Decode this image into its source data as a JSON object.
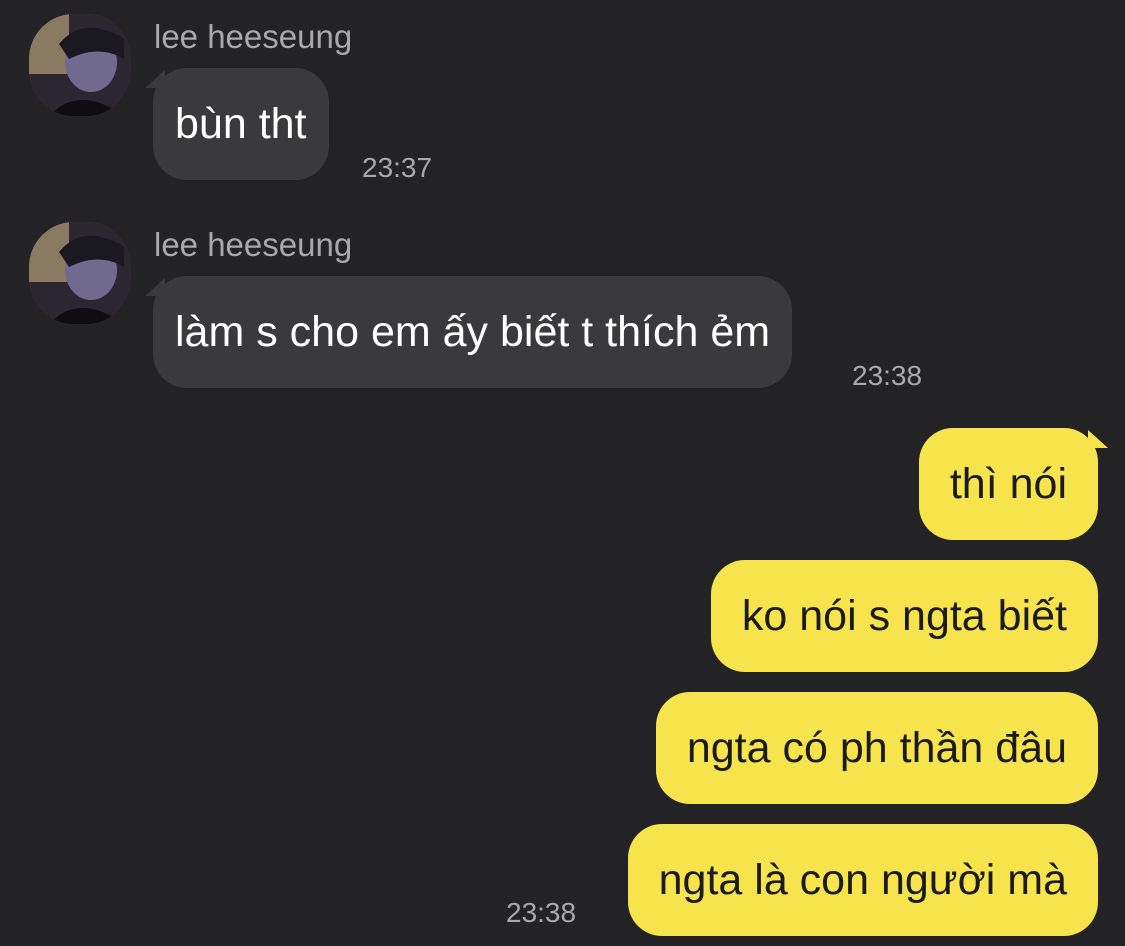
{
  "chat": {
    "messages_in": [
      {
        "sender": "lee heeseung",
        "text": "bùn tht",
        "time": "23:37"
      },
      {
        "sender": "lee heeseung",
        "text": "làm s cho em ấy biết t thích ẻm",
        "time": "23:38"
      }
    ],
    "messages_out": [
      {
        "text": "thì nói"
      },
      {
        "text": "ko nói s ngta biết"
      },
      {
        "text": "ngta có ph thần đâu"
      },
      {
        "text": "ngta là con người mà"
      }
    ],
    "out_time": "23:38"
  },
  "colors": {
    "background": "#232325",
    "incoming_bubble": "#3a3a3c",
    "outgoing_bubble": "#f7e44c",
    "meta_text": "#a9a9ad"
  }
}
